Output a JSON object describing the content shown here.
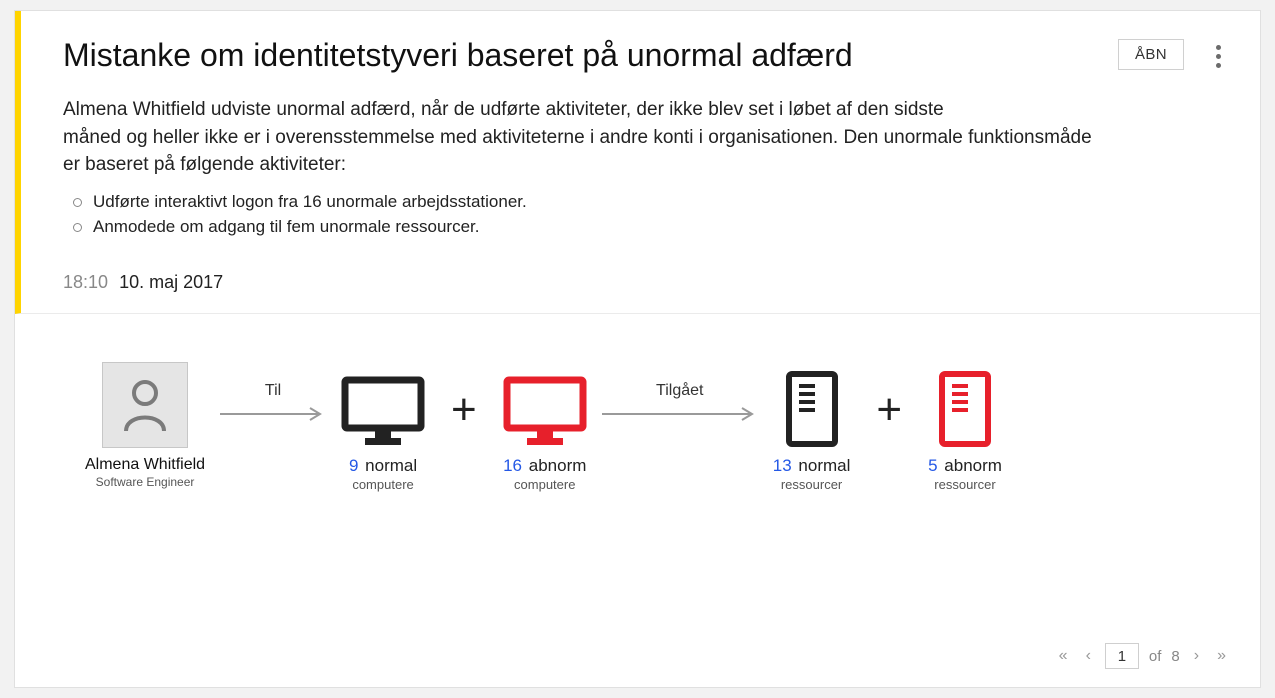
{
  "header": {
    "title": "Mistanke om identitetstyveri baseret på unormal adfærd",
    "open_label": "ÅBN",
    "description_line1": "Almena Whitfield udviste unormal adfærd, når de udførte aktiviteter, der ikke blev set i løbet af den sidste",
    "description_line2": "måned og heller ikke er i overensstemmelse med aktiviteterne i andre konti i organisationen. Den unormale funktionsmåde",
    "description_line3": "er baseret på følgende aktiviteter:",
    "bullets": [
      "Udførte interaktivt logon fra 16 unormale arbejdsstationer.",
      "Anmodede om adgang til fem unormale ressourcer."
    ],
    "time": "18:10",
    "date": "10. maj 2017"
  },
  "diagram": {
    "user": {
      "name": "Almena Whitfield",
      "role": "Software Engineer"
    },
    "arrow1_label": "Til",
    "arrow2_label": "Tilgået",
    "computers_normal": {
      "count": "9",
      "label": "normal",
      "sub": "computere"
    },
    "computers_abnormal": {
      "count": "16",
      "label": "abnorm",
      "sub": "computere"
    },
    "resources_normal": {
      "count": "13",
      "label": "normal",
      "sub": "ressourcer"
    },
    "resources_abnormal": {
      "count": "5",
      "label": "abnorm",
      "sub": "ressourcer"
    },
    "colors": {
      "normal": "#222222",
      "abnormal": "#e7202b"
    }
  },
  "pager": {
    "current": "1",
    "of_label": "of",
    "total": "8"
  }
}
